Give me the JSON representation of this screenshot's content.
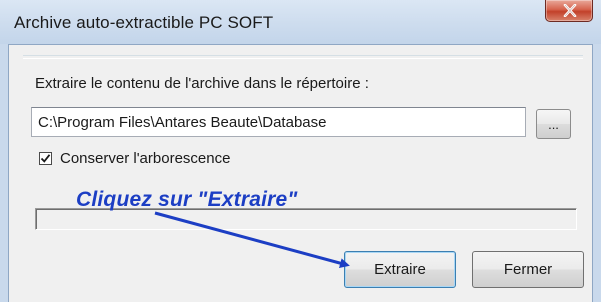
{
  "window": {
    "title": "Archive auto-extractible PC SOFT",
    "close_icon": "close-icon"
  },
  "dialog": {
    "extract_label": "Extraire le contenu de l'archive dans le répertoire :",
    "path_value": "C:\\Program Files\\Antares Beaute\\Database",
    "browse_label": "...",
    "preserve_tree_label": "Conserver l'arborescence",
    "preserve_tree_checked": true,
    "progress_fraction": 0,
    "extract_button_label": "Extraire",
    "close_button_label": "Fermer"
  },
  "annotation": {
    "text": "Cliquez sur \"Extraire\"",
    "color": "#1c3ec4"
  }
}
